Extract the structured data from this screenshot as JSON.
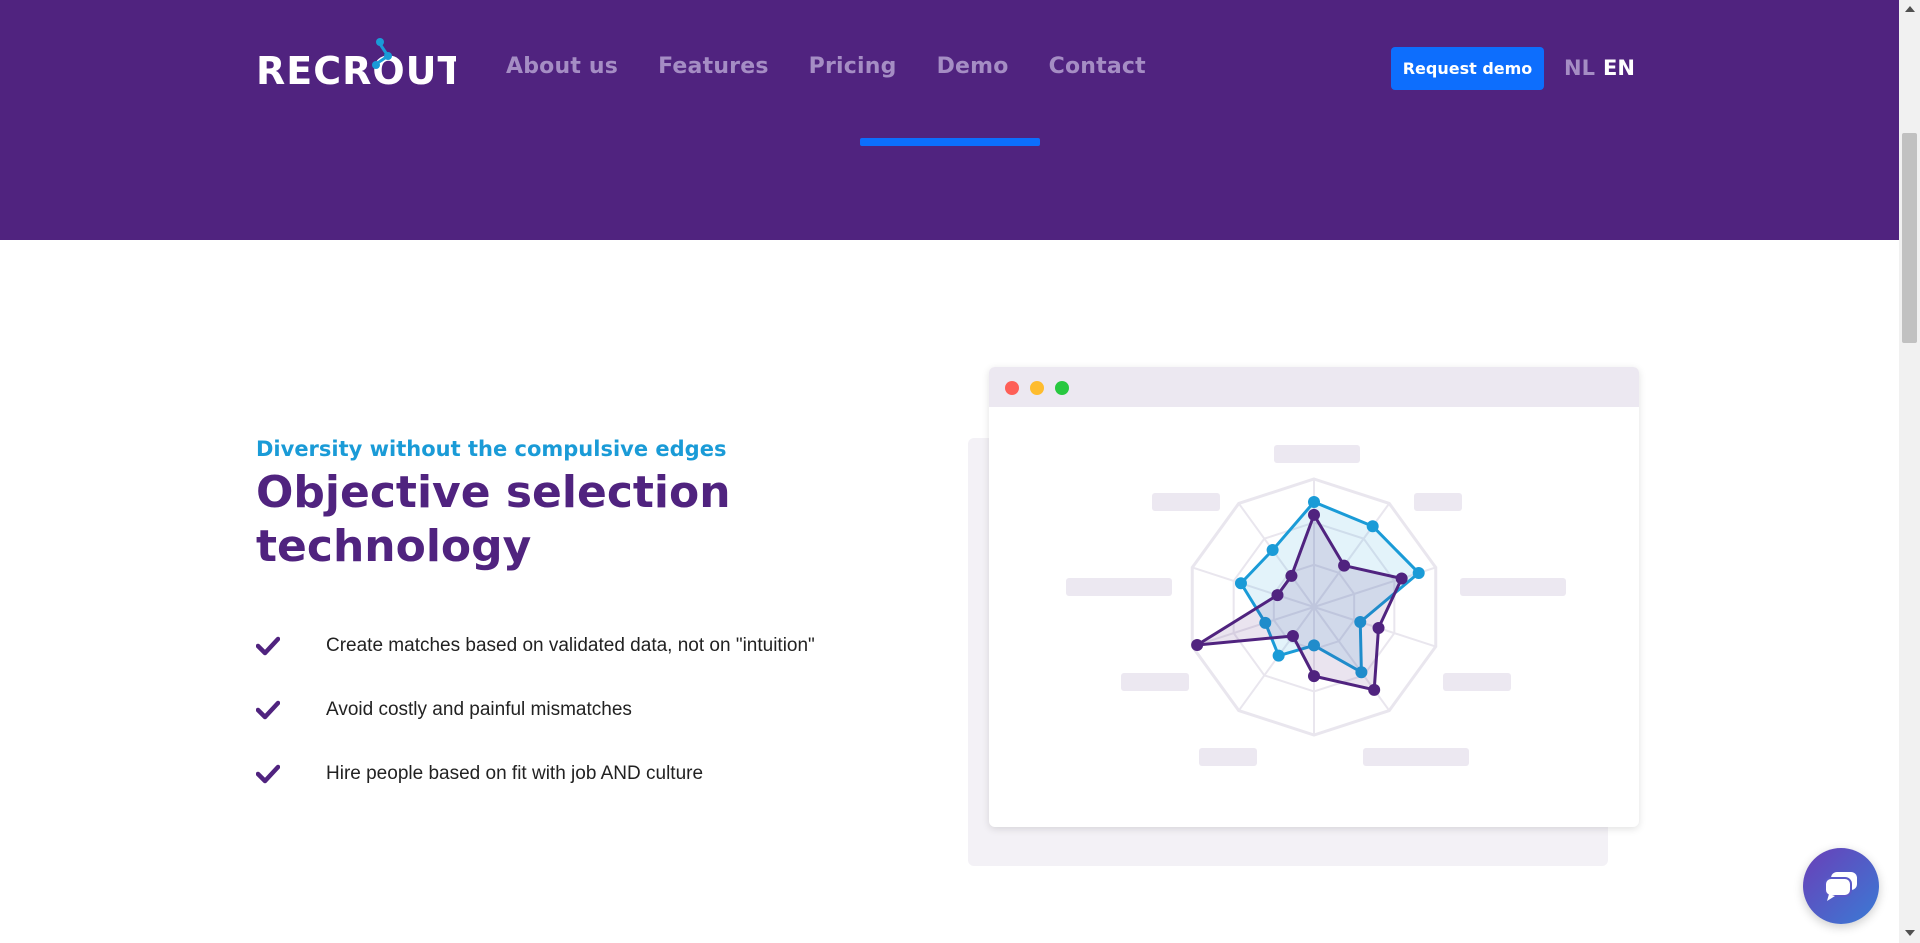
{
  "brand": {
    "name": "RECROUT",
    "primary": "#50237f",
    "accent": "#0d6efd",
    "secondary": "#1a9bd7"
  },
  "nav": {
    "items": [
      {
        "label": "About us"
      },
      {
        "label": "Features"
      },
      {
        "label": "Pricing"
      },
      {
        "label": "Demo"
      },
      {
        "label": "Contact"
      }
    ],
    "active": "Demo",
    "cta_label": "Request demo",
    "languages": [
      "NL",
      "EN"
    ],
    "active_language": "EN"
  },
  "section": {
    "eyebrow": "Diversity without the compulsive edges",
    "title": "Objective selection technology",
    "features": [
      {
        "text": "Create matches based on validated data, not on \"intuition\"",
        "icon": "check-icon"
      },
      {
        "text": "Avoid costly and painful mismatches",
        "icon": "check-icon"
      },
      {
        "text": "Hire people based on fit with job AND culture",
        "icon": "check-icon"
      }
    ]
  },
  "illustration": {
    "window_controls": [
      "close-dot",
      "minimize-dot",
      "maximize-dot"
    ],
    "radar": {
      "axes_count": 10,
      "series": [
        {
          "color": "#1a9bd7",
          "values": [
            0.82,
            0.78,
            0.86,
            0.38,
            0.63,
            0.3,
            0.47,
            0.4,
            0.6,
            0.55
          ]
        },
        {
          "color": "#50237f",
          "values": [
            0.72,
            0.4,
            0.72,
            0.53,
            0.8,
            0.54,
            0.28,
            0.96,
            0.3,
            0.3
          ]
        }
      ]
    }
  },
  "chat_widget": {
    "icon": "chat-bubble-icon"
  }
}
